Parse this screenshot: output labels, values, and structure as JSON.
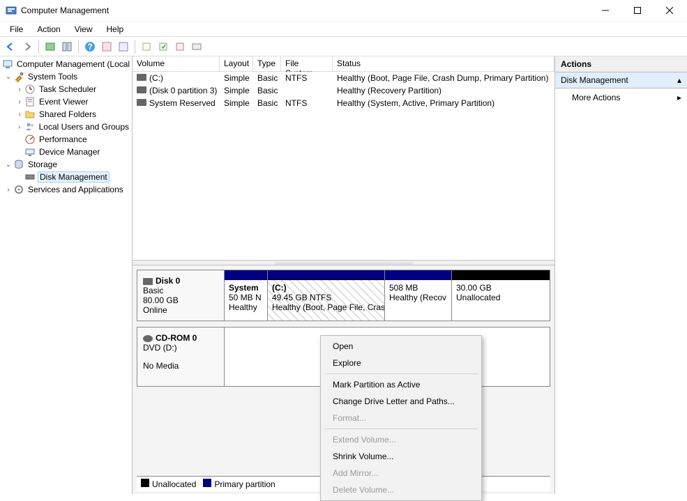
{
  "window": {
    "title": "Computer Management"
  },
  "menubar": [
    "File",
    "Action",
    "View",
    "Help"
  ],
  "tree": {
    "root": "Computer Management (Local",
    "system_tools": "System Tools",
    "task_scheduler": "Task Scheduler",
    "event_viewer": "Event Viewer",
    "shared_folders": "Shared Folders",
    "local_users": "Local Users and Groups",
    "performance": "Performance",
    "device_manager": "Device Manager",
    "storage": "Storage",
    "disk_management": "Disk Management",
    "services": "Services and Applications"
  },
  "columns": {
    "volume": "Volume",
    "layout": "Layout",
    "type": "Type",
    "filesystem": "File System",
    "status": "Status"
  },
  "volumes": [
    {
      "name": "(C:)",
      "layout": "Simple",
      "type": "Basic",
      "fs": "NTFS",
      "status": "Healthy (Boot, Page File, Crash Dump, Primary Partition)"
    },
    {
      "name": "(Disk 0 partition 3)",
      "layout": "Simple",
      "type": "Basic",
      "fs": "",
      "status": "Healthy (Recovery Partition)"
    },
    {
      "name": "System Reserved",
      "layout": "Simple",
      "type": "Basic",
      "fs": "NTFS",
      "status": "Healthy (System, Active, Primary Partition)"
    }
  ],
  "disks": {
    "disk0": {
      "name": "Disk 0",
      "type": "Basic",
      "size": "80.00 GB",
      "state": "Online"
    },
    "cdrom": {
      "name": "CD-ROM 0",
      "type": "DVD (D:)",
      "state": "No Media"
    }
  },
  "partitions": {
    "p0": {
      "name": "System",
      "size": "50 MB N",
      "status": "Healthy"
    },
    "p1": {
      "name": "(C:)",
      "size": "49.45 GB NTFS",
      "status": "Healthy (Boot, Page File, Cras"
    },
    "p2": {
      "name": "",
      "size": "508 MB",
      "status": "Healthy (Recov"
    },
    "p3": {
      "name": "",
      "size": "30.00 GB",
      "status": "Unallocated"
    }
  },
  "legend": {
    "unallocated": "Unallocated",
    "primary": "Primary partition"
  },
  "actions": {
    "header": "Actions",
    "section": "Disk Management",
    "more": "More Actions"
  },
  "context_menu": {
    "open": "Open",
    "explore": "Explore",
    "mark_active": "Mark Partition as Active",
    "change_letter": "Change Drive Letter and Paths...",
    "format": "Format...",
    "extend": "Extend Volume...",
    "shrink": "Shrink Volume...",
    "add_mirror": "Add Mirror...",
    "delete": "Delete Volume..."
  }
}
